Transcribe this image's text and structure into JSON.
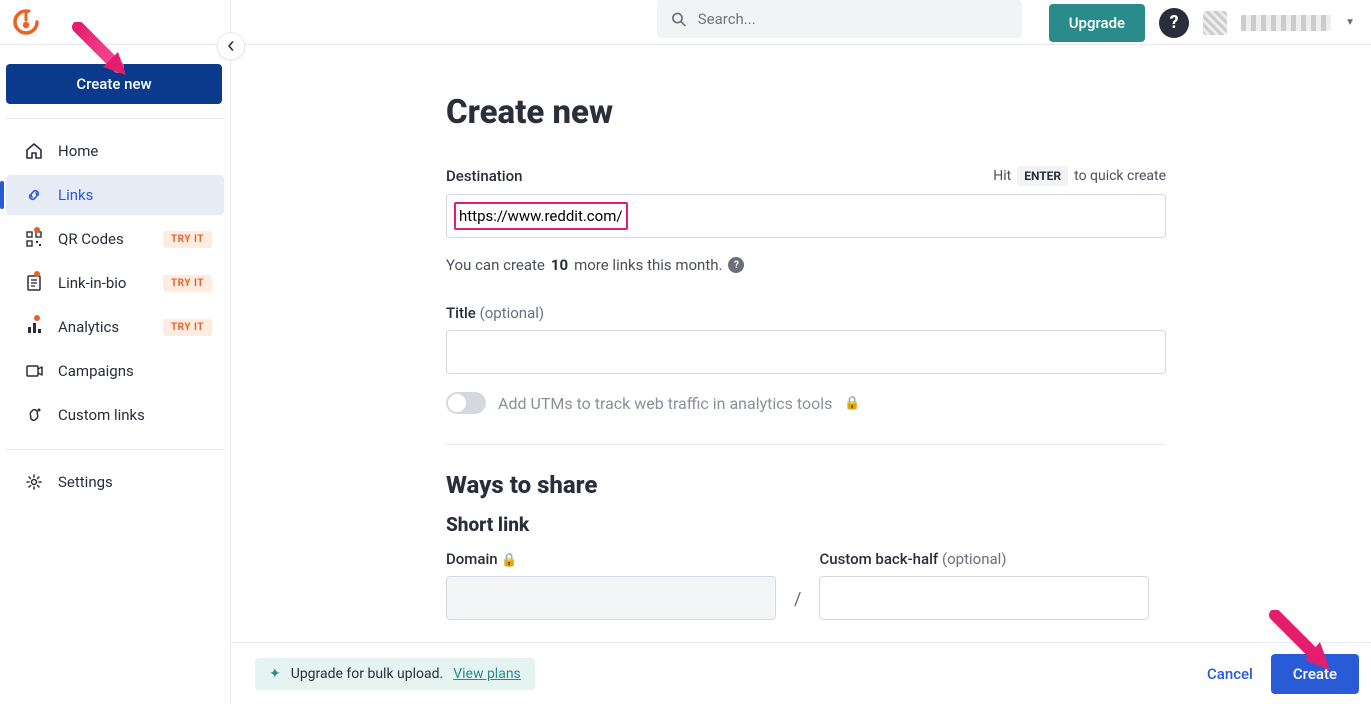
{
  "header": {
    "search_placeholder": "Search...",
    "upgrade_label": "Upgrade"
  },
  "sidebar": {
    "create_new_label": "Create new",
    "items": [
      {
        "label": "Home"
      },
      {
        "label": "Links"
      },
      {
        "label": "QR Codes",
        "badge": "TRY IT"
      },
      {
        "label": "Link-in-bio",
        "badge": "TRY IT"
      },
      {
        "label": "Analytics",
        "badge": "TRY IT"
      },
      {
        "label": "Campaigns"
      },
      {
        "label": "Custom links"
      },
      {
        "label": "Settings"
      }
    ]
  },
  "main": {
    "title": "Create new",
    "destination_label": "Destination",
    "hint_prefix": "Hit",
    "hint_key": "ENTER",
    "hint_suffix": "to quick create",
    "destination_value": "https://www.reddit.com/",
    "count_prefix": "You can create",
    "count_value": "10",
    "count_suffix": "more links this month.",
    "title_label": "Title",
    "optional": "(optional)",
    "utm_label": "Add UTMs to track web traffic in analytics tools",
    "ways_heading": "Ways to share",
    "short_heading": "Short link",
    "domain_label": "Domain",
    "backhalf_label": "Custom back-half",
    "slash": "/"
  },
  "footer": {
    "bulk_text": "Upgrade for bulk upload.",
    "bulk_link": "View plans",
    "cancel_label": "Cancel",
    "create_label": "Create"
  }
}
